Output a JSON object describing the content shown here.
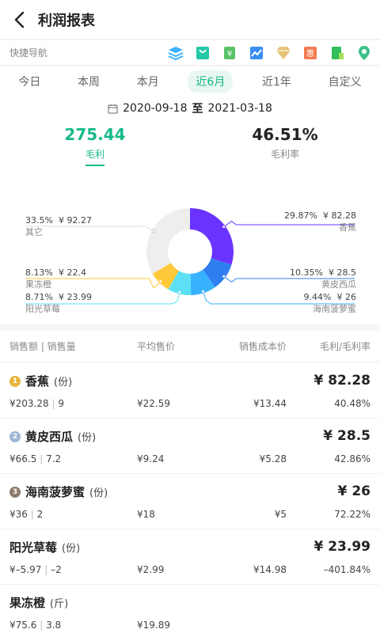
{
  "header": {
    "title": "利润报表"
  },
  "quicknav": {
    "label": "快捷导航"
  },
  "tabs": [
    "今日",
    "本周",
    "本月",
    "近6月",
    "近1年",
    "自定义"
  ],
  "date_range": {
    "start": "2020-09-18",
    "sep": "至",
    "end": "2021-03-18"
  },
  "summary": {
    "profit": {
      "value": "275.44",
      "label": "毛利"
    },
    "rate": {
      "value": "46.51%",
      "label": "毛利率"
    }
  },
  "chart_data": {
    "type": "pie",
    "slices": [
      {
        "name": "香蕉",
        "percent": 29.87,
        "value": "¥ 82.28",
        "color": "#6a33ff"
      },
      {
        "name": "黄皮西瓜",
        "percent": 10.35,
        "value": "¥ 28.5",
        "color": "#2f7ff0"
      },
      {
        "name": "海南菠萝蜜",
        "percent": 9.44,
        "value": "¥ 26",
        "color": "#38b2ff"
      },
      {
        "name": "阳光草莓",
        "percent": 8.71,
        "value": "¥ 23.99",
        "color": "#5ce0f5"
      },
      {
        "name": "果冻橙",
        "percent": 8.13,
        "value": "¥ 22.4",
        "color": "#ffc93a"
      },
      {
        "name": "其它",
        "percent": 33.5,
        "value": "¥ 92.27",
        "color": "#eeeeee"
      }
    ],
    "labels": {
      "banana": {
        "pct": "29.87%",
        "val": "¥ 82.28",
        "name": "香蕉"
      },
      "melon": {
        "pct": "10.35%",
        "val": "¥ 28.5",
        "name": "黄皮西瓜"
      },
      "jack": {
        "pct": "9.44%",
        "val": "¥ 26",
        "name": "海南菠萝蜜"
      },
      "straw": {
        "pct": "8.71%",
        "val": "¥ 23.99",
        "name": "阳光草莓"
      },
      "orange": {
        "pct": "8.13%",
        "val": "¥ 22.4",
        "name": "果冻橙"
      },
      "other": {
        "pct": "33.5%",
        "val": "¥ 92.27",
        "name": "其它"
      }
    }
  },
  "table": {
    "headers": [
      "销售额 | 销售量",
      "平均售价",
      "销售成本价",
      "毛利/毛利率"
    ],
    "rows": [
      {
        "rank": "1",
        "name": "香蕉",
        "unit": "(份)",
        "profit": "¥ 82.28",
        "sales": "¥203.28",
        "qty": "9",
        "avg": "¥22.59",
        "cost": "¥13.44",
        "rate": "40.48%"
      },
      {
        "rank": "2",
        "name": "黄皮西瓜",
        "unit": "(份)",
        "profit": "¥ 28.5",
        "sales": "¥66.5",
        "qty": "7.2",
        "avg": "¥9.24",
        "cost": "¥5.28",
        "rate": "42.86%"
      },
      {
        "rank": "3",
        "name": "海南菠萝蜜",
        "unit": "(份)",
        "profit": "¥ 26",
        "sales": "¥36",
        "qty": "2",
        "avg": "¥18",
        "cost": "¥5",
        "rate": "72.22%"
      },
      {
        "rank": "",
        "name": "阳光草莓",
        "unit": "(份)",
        "profit": "¥ 23.99",
        "sales": "¥–5.97",
        "qty": "–2",
        "avg": "¥2.99",
        "cost": "¥14.98",
        "rate": "–401.84%"
      },
      {
        "rank": "",
        "name": "果冻橙",
        "unit": "(斤)",
        "profit": "",
        "sales": "¥75.6",
        "qty": "3.8",
        "avg": "¥19.89",
        "cost": "",
        "rate": ""
      }
    ]
  },
  "colors": {
    "accent": "#17b98a",
    "gold": "#e6b43c",
    "silver": "#9fb6d6",
    "bronze": "#8c7b6a"
  }
}
